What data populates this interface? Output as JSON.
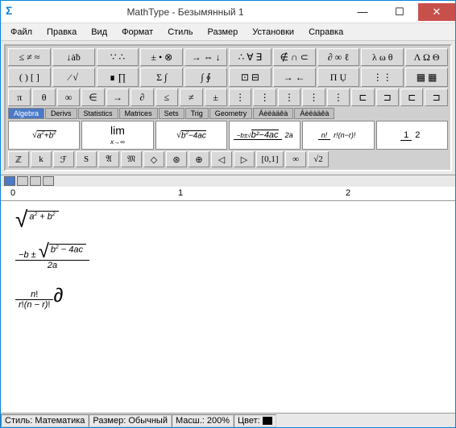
{
  "window": {
    "title": "MathType - Безымянный 1",
    "icon": "Σ"
  },
  "winbtns": {
    "min": "—",
    "max": "☐",
    "close": "✕"
  },
  "menu": [
    "Файл",
    "Правка",
    "Вид",
    "Формат",
    "Стиль",
    "Размер",
    "Установки",
    "Справка"
  ],
  "row1": [
    "≤ ≠ ≈",
    "↓ȧḃ",
    "∵ ∴",
    "± • ⊗",
    "→ ⇔ ↓",
    "∴ ∀ ∃",
    "∉ ∩ ⊂",
    "∂ ∞ ℓ",
    "λ ω θ",
    "Λ Ω Θ"
  ],
  "row2": [
    "( ) [ ]",
    "⁄ √",
    "∎ ∏",
    "Σ ∫",
    "∫ ∮",
    "⊡ ⊟",
    "→ ←",
    "Π Ụ",
    "⋮⋮",
    "▦ ▦"
  ],
  "row3": [
    "π",
    "θ",
    "∞",
    "∈",
    "→",
    "∂",
    "≤",
    "≠",
    "±",
    "⋮",
    "⋮",
    "⋮",
    "⋮",
    "⋮",
    "⊏",
    "⊐",
    "⊏",
    "⊐"
  ],
  "tabs": [
    "Algebra",
    "Derivs",
    "Statistics",
    "Matrices",
    "Sets",
    "Trig",
    "Geometry",
    "Áèëàäêà",
    "Áèëàäêà"
  ],
  "tabActive": 0,
  "templates": {
    "t1": "√(a²+b²)",
    "t2": "lim x→∞",
    "t3": "√(b²−4ac)",
    "t4": "(-b±√(b²-4ac))/2a",
    "t5": "n!/(r!(n−r)!)",
    "t6": "1/2"
  },
  "row5": [
    "ℤ",
    "k",
    "ℱ",
    "S",
    "𝔄",
    "𝔐",
    "◇",
    "⊛",
    "⊕",
    "◁",
    "▷",
    "[0,1]",
    "∞",
    "√2"
  ],
  "ruler": {
    "m0": "0",
    "m1": "1",
    "m2": "2"
  },
  "status": {
    "style_lbl": "Стиль:",
    "style_val": "Математика",
    "size_lbl": "Размер:",
    "size_val": "Обычный",
    "zoom_lbl": "Масш.:",
    "zoom_val": "200%",
    "color_lbl": "Цвет:"
  }
}
